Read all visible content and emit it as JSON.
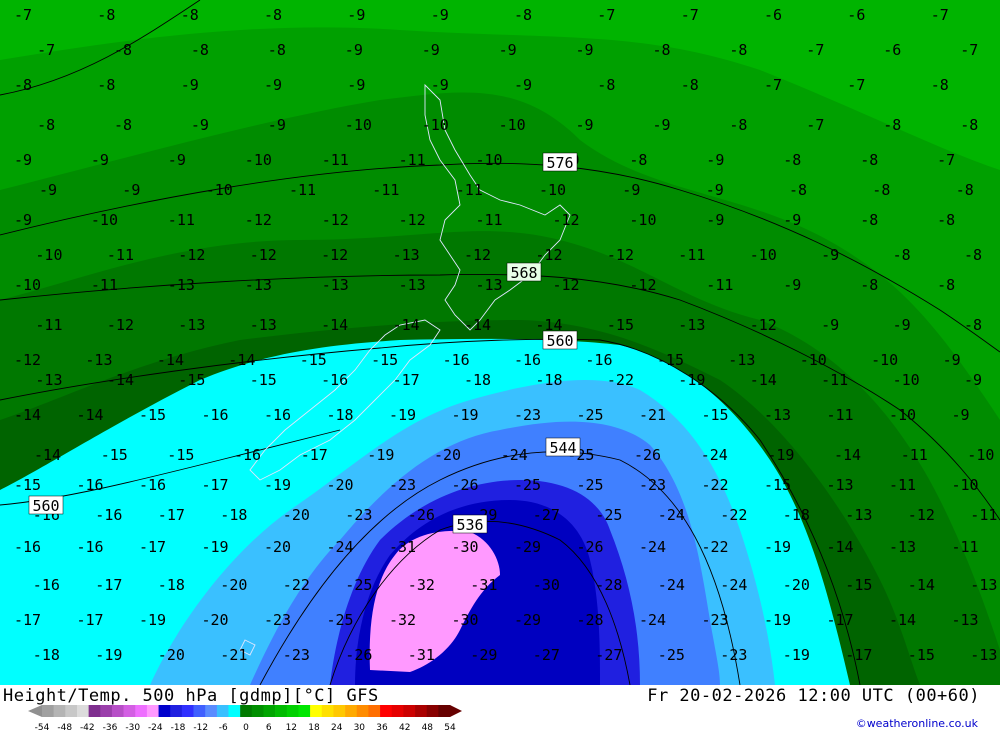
{
  "title": "Height/Temp. 500 hPa [gdmp][°C] GFS",
  "valid_time": "Fr 20-02-2026 12:00 UTC (00+60)",
  "credit": "©weatheronline.co.uk",
  "height_labels": [
    {
      "value": "576"
    },
    {
      "value": "568"
    },
    {
      "value": "560"
    },
    {
      "value": "560"
    },
    {
      "value": "544"
    },
    {
      "value": "536"
    }
  ],
  "legend": {
    "ticks": [
      "-54",
      "-48",
      "-42",
      "-36",
      "-30",
      "-24",
      "-18",
      "-12",
      "-6",
      "0",
      "6",
      "12",
      "18",
      "24",
      "30",
      "36",
      "42",
      "48",
      "54"
    ],
    "colors": [
      "#a0a0a0",
      "#b4b4b4",
      "#c8c8c8",
      "#dcdcdc",
      "#7f2f8f",
      "#9b3fab",
      "#b74fc7",
      "#d35fe3",
      "#ee6fff",
      "#ff99ff",
      "#0000cc",
      "#2020e0",
      "#3030ff",
      "#4060ff",
      "#5a8cff",
      "#3ac0ff",
      "#00ffff",
      "#007a00",
      "#008f00",
      "#00a500",
      "#00bb00",
      "#00d000",
      "#00e600",
      "#ffff00",
      "#ffe000",
      "#ffc800",
      "#ffaa00",
      "#ff8c00",
      "#ff6e00",
      "#ff0000",
      "#e60000",
      "#cc0000",
      "#aa0000",
      "#880000",
      "#660000"
    ]
  },
  "temperature_labels": [
    "-7",
    "-8",
    "-8",
    "-8",
    "-9",
    "-9",
    "-8",
    "-7",
    "-7",
    "-6",
    "-6",
    "-7",
    "-7",
    "-8",
    "-8",
    "-8",
    "-9",
    "-9",
    "-9",
    "-9",
    "-8",
    "-8",
    "-7",
    "-6",
    "-7",
    "-8",
    "-8",
    "-9",
    "-9",
    "-9",
    "-9",
    "-9",
    "-8",
    "-8",
    "-7",
    "-7",
    "-8",
    "-8",
    "-8",
    "-9",
    "-9",
    "-10",
    "-10",
    "-10",
    "-9",
    "-9",
    "-8",
    "-7",
    "-8",
    "-8",
    "-9",
    "-9",
    "-9",
    "-10",
    "-11",
    "-11",
    "-10",
    "-10",
    "-8",
    "-9",
    "-8",
    "-8",
    "-7",
    "-9",
    "-9",
    "-10",
    "-11",
    "-11",
    "-11",
    "-10",
    "-9",
    "-9",
    "-8",
    "-8",
    "-8",
    "-9",
    "-10",
    "-11",
    "-12",
    "-12",
    "-12",
    "-11",
    "-12",
    "-10",
    "-9",
    "-9",
    "-8",
    "-8",
    "-10",
    "-11",
    "-12",
    "-12",
    "-12",
    "-13",
    "-12",
    "-12",
    "-12",
    "-11",
    "-10",
    "-9",
    "-8",
    "-8",
    "-10",
    "-11",
    "-13",
    "-13",
    "-13",
    "-13",
    "-13",
    "-12",
    "-12",
    "-11",
    "-9",
    "-8",
    "-8",
    "-11",
    "-12",
    "-13",
    "-13",
    "-14",
    "-14",
    "-14",
    "-14",
    "-15",
    "-13",
    "-12",
    "-9",
    "-9",
    "-8",
    "-12",
    "-13",
    "-14",
    "-14",
    "-15",
    "-15",
    "-16",
    "-16",
    "-16",
    "-15",
    "-13",
    "-10",
    "-10",
    "-9",
    "-13",
    "-14",
    "-15",
    "-15",
    "-16",
    "-17",
    "-18",
    "-18",
    "-22",
    "-19",
    "-14",
    "-11",
    "-10",
    "-9",
    "-14",
    "-14",
    "-15",
    "-16",
    "-16",
    "-18",
    "-19",
    "-19",
    "-23",
    "-25",
    "-21",
    "-15",
    "-13",
    "-11",
    "-10",
    "-9",
    "-14",
    "-15",
    "-15",
    "-16",
    "-17",
    "-19",
    "-20",
    "-24",
    "-25",
    "-26",
    "-24",
    "-19",
    "-14",
    "-11",
    "-10",
    "-15",
    "-16",
    "-16",
    "-17",
    "-19",
    "-20",
    "-23",
    "-26",
    "-25",
    "-25",
    "-23",
    "-22",
    "-15",
    "-13",
    "-11",
    "-10",
    "-16",
    "-16",
    "-17",
    "-18",
    "-20",
    "-23",
    "-26",
    "-29",
    "-27",
    "-25",
    "-24",
    "-22",
    "-18",
    "-13",
    "-12",
    "-11",
    "-16",
    "-16",
    "-17",
    "-19",
    "-20",
    "-24",
    "-31",
    "-30",
    "-29",
    "-26",
    "-24",
    "-22",
    "-19",
    "-14",
    "-13",
    "-11",
    "-16",
    "-17",
    "-18",
    "-20",
    "-22",
    "-25",
    "-32",
    "-31",
    "-30",
    "-28",
    "-24",
    "-24",
    "-20",
    "-15",
    "-14",
    "-13",
    "-17",
    "-17",
    "-19",
    "-20",
    "-23",
    "-25",
    "-32",
    "-30",
    "-29",
    "-28",
    "-24",
    "-23",
    "-19",
    "-17",
    "-14",
    "-13",
    "-18",
    "-19",
    "-20",
    "-21",
    "-23",
    "-26",
    "-31",
    "-29",
    "-27",
    "-27",
    "-25",
    "-23",
    "-19",
    "-17",
    "-15",
    "-13"
  ]
}
